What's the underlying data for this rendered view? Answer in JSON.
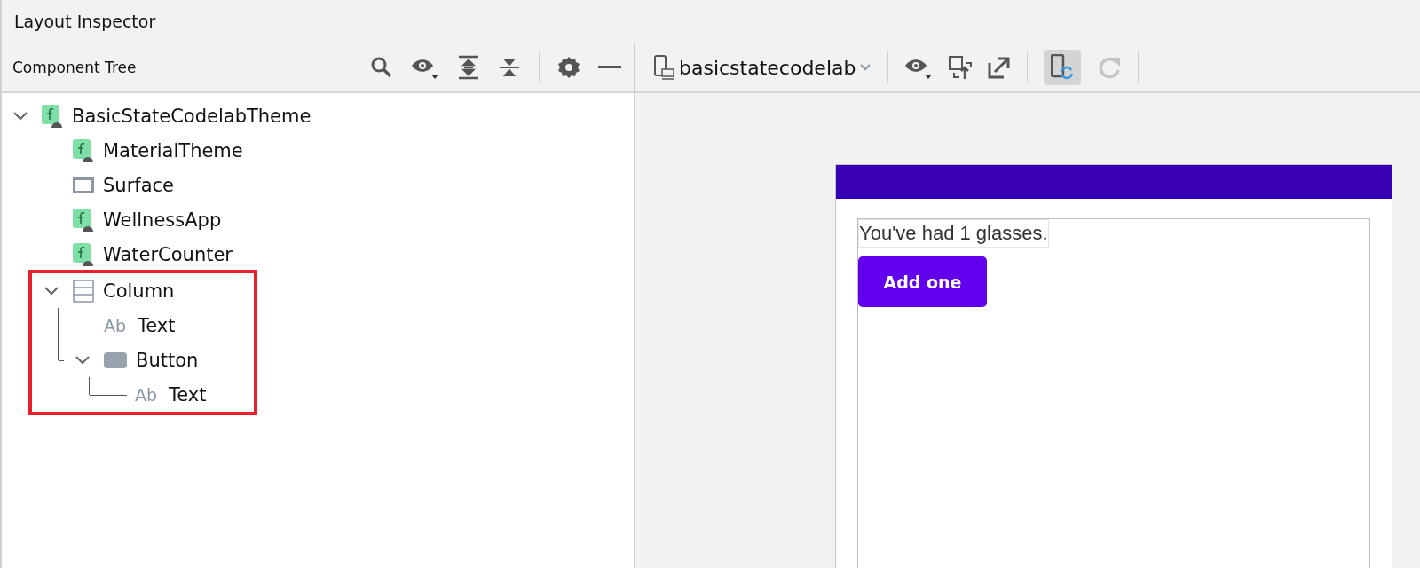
{
  "window": {
    "title": "Layout Inspector"
  },
  "component_tree": {
    "title": "Component Tree",
    "nodes": [
      {
        "label": "BasicStateCodelabTheme",
        "kind": "compose",
        "expanded": true,
        "children": [
          {
            "label": "MaterialTheme",
            "kind": "compose"
          },
          {
            "label": "Surface",
            "kind": "surface"
          },
          {
            "label": "WellnessApp",
            "kind": "compose"
          },
          {
            "label": "WaterCounter",
            "kind": "compose"
          },
          {
            "label": "Column",
            "kind": "column",
            "expanded": true,
            "highlighted": true,
            "children": [
              {
                "label": "Text",
                "kind": "text",
                "icon_text": "Ab"
              },
              {
                "label": "Button",
                "kind": "button",
                "expanded": true,
                "children": [
                  {
                    "label": "Text",
                    "kind": "text",
                    "icon_text": "Ab"
                  }
                ]
              }
            ]
          }
        ]
      }
    ]
  },
  "device_toolbar": {
    "process": "basicstatecodelab",
    "live_updates": {
      "selected": true
    },
    "refresh": {
      "disabled": true
    }
  },
  "preview": {
    "text": "You've had 1 glasses.",
    "button": "Add one"
  }
}
